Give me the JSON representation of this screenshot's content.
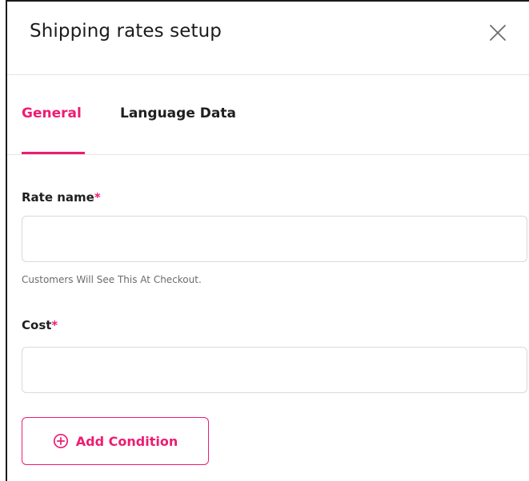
{
  "dialog": {
    "title": "Shipping rates setup",
    "close_icon": "close-icon"
  },
  "tabs": [
    {
      "label": "General",
      "active": true
    },
    {
      "label": "Language Data",
      "active": false
    }
  ],
  "form": {
    "rate_name": {
      "label": "Rate name",
      "required_mark": "*",
      "value": "",
      "placeholder": "",
      "hint": "Customers Will See This At Checkout."
    },
    "cost": {
      "label": "Cost",
      "required_mark": "*",
      "value": "",
      "placeholder": ""
    },
    "add_condition": {
      "label": "Add Condition",
      "icon": "plus-circle-icon"
    }
  },
  "colors": {
    "accent": "#ee1c72",
    "text": "#1f1f1f",
    "border": "#d9d9d9"
  }
}
